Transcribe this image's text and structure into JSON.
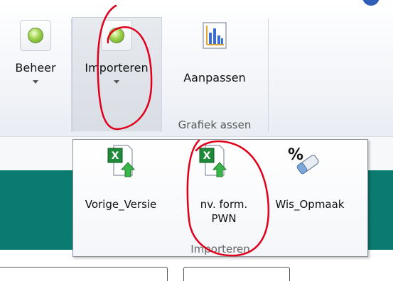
{
  "ribbon": {
    "beheer_label": "Beheer",
    "importeren_label": "Importeren",
    "aanpassen_label": "Aanpassen",
    "group_label": "Grafiek assen"
  },
  "popup": {
    "items": [
      {
        "label": "Vorige_Versie",
        "icon": "excel-import-icon"
      },
      {
        "label": "nv. form.",
        "label2": "PWN",
        "icon": "excel-import-icon"
      },
      {
        "label": "Wis_Opmaak",
        "icon": "clear-format-icon"
      }
    ],
    "group_label": "Importeren"
  },
  "colors": {
    "teal": "#0b7a6f",
    "annotation_red": "#e0001b"
  }
}
